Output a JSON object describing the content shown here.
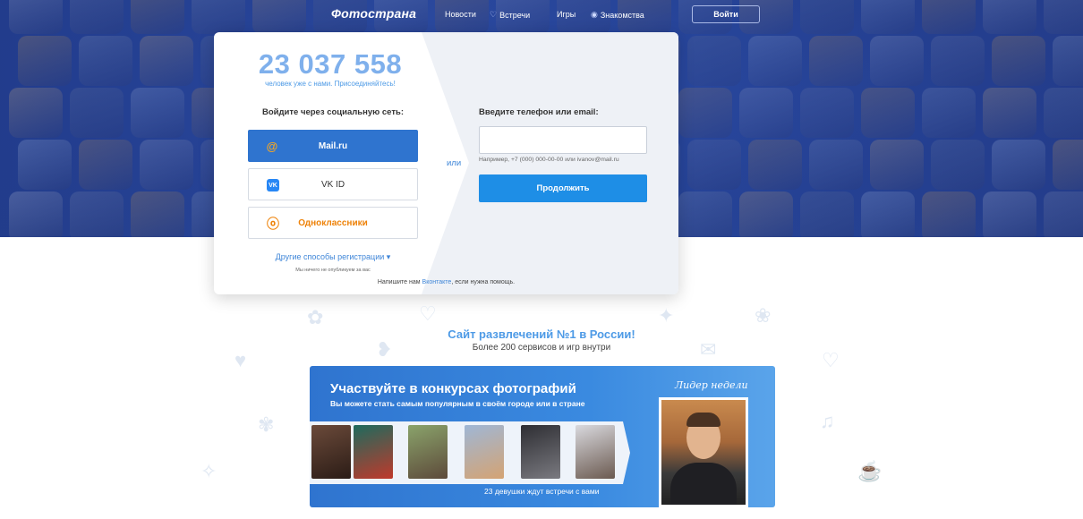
{
  "nav": {
    "logo": "Фотострана",
    "items": [
      {
        "label": "Новости",
        "icon": ""
      },
      {
        "label": "Встречи",
        "icon": "heart-icon"
      },
      {
        "label": "Игры",
        "icon": ""
      },
      {
        "label": "Знакомства",
        "icon": "globe-icon"
      }
    ],
    "login_label": "Войти"
  },
  "card": {
    "counter": "23 037 558",
    "counter_sub": "человек уже с нами. Присоединяйтесь!",
    "social_title": "Войдите через социальную сеть:",
    "social_buttons": [
      {
        "label": "Mail.ru",
        "icon": "mailru-icon"
      },
      {
        "label": "VK ID",
        "icon": "vk-icon"
      },
      {
        "label": "Одноклассники",
        "icon": "ok-icon"
      }
    ],
    "other_ways": "Другие способы регистрации",
    "no_publish": "Мы ничего не опубликуем за вас",
    "or": "или",
    "phone_title": "Введите телефон или email:",
    "phone_value": "",
    "phone_hint": "Например, +7 (000) 000-00-00 или ivanov@mail.ru",
    "continue_label": "Продолжить",
    "help_prefix": "Напишите нам",
    "help_link": "Вконтакте",
    "help_suffix": ", если нужна помощь."
  },
  "promo": {
    "title": "Сайт развлечений №1 в России!",
    "subtitle": "Более 200 сервисов и игр внутри"
  },
  "banner": {
    "title": "Участвуйте в конкурсах фотографий",
    "subtitle": "Вы можете стать самым популярным в своём городе или в стране",
    "caption": "23 девушки ждут встречи с вами",
    "leader_label": "Лидер недели"
  },
  "colors": {
    "hero_bg": "#2a4a9e",
    "accent_blue": "#1e8ee6",
    "mailru_button": "#2f74cf",
    "ok_orange": "#ee8208",
    "counter": "#7fb0ec"
  }
}
